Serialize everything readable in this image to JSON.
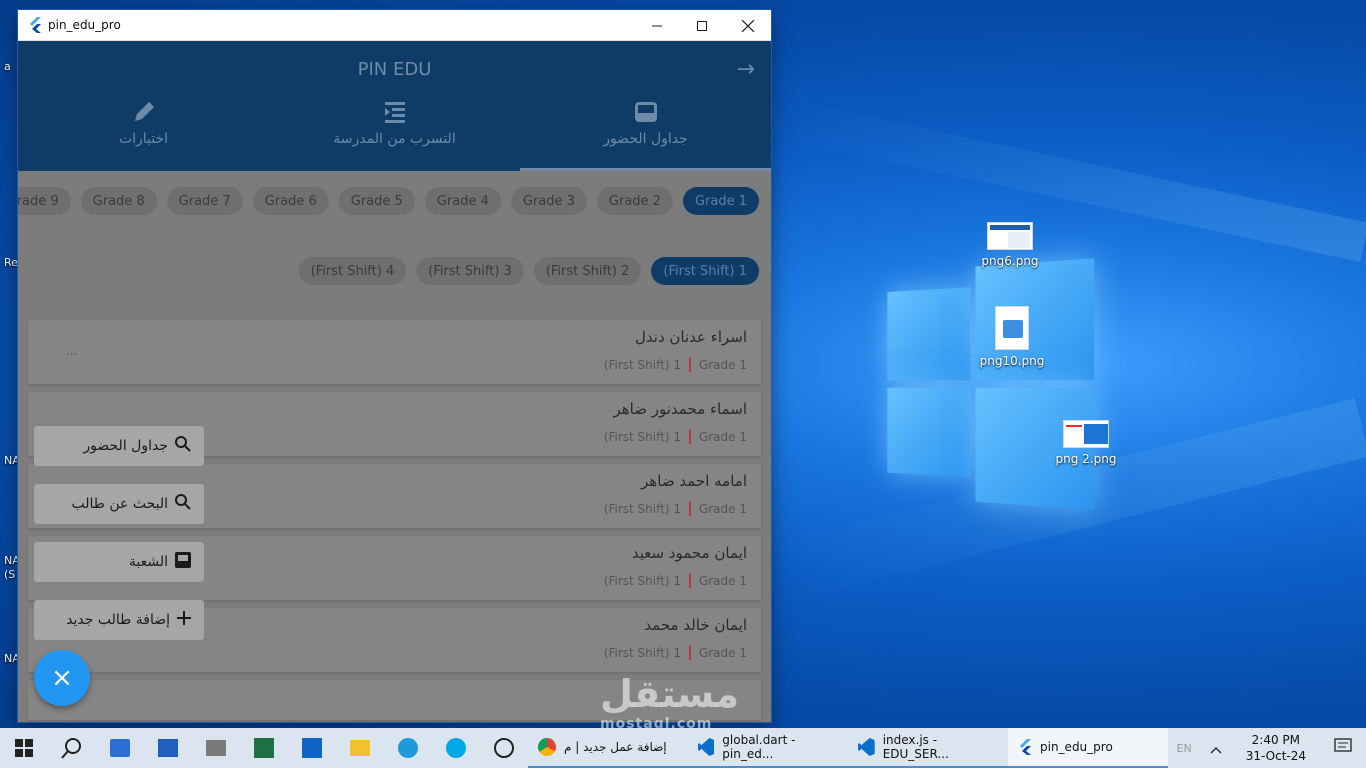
{
  "window": {
    "title": "pin_edu_pro",
    "minimize_icon": "minimize-icon",
    "maximize_icon": "maximize-icon",
    "close_icon": "close-icon"
  },
  "appbar": {
    "title": "PIN EDU",
    "back_symbol": "→",
    "tabs": [
      {
        "label": "جداول الحضور",
        "icon": "inbox-icon",
        "active": true
      },
      {
        "label": "التسرب من المدرسة",
        "icon": "list-indent-icon",
        "active": false
      },
      {
        "label": "اختبارات",
        "icon": "pencil-icon",
        "active": false
      }
    ]
  },
  "grades": [
    "Grade 1",
    "Grade 2",
    "Grade 3",
    "Grade 4",
    "Grade 5",
    "Grade 6",
    "Grade 7",
    "Grade 8",
    "rade 9"
  ],
  "shifts": [
    "(First Shift) 1",
    "(First Shift) 2",
    "(First Shift) 3",
    "(First Shift) 4"
  ],
  "students": [
    {
      "name": "اسراء عدنان دندل",
      "grade": "Grade 1",
      "shift": "(First Shift) 1"
    },
    {
      "name": "اسماء محمدنور ضاهر",
      "grade": "Grade 1",
      "shift": "(First Shift) 1"
    },
    {
      "name": "امامه احمد ضاهر",
      "grade": "Grade 1",
      "shift": "(First Shift) 1"
    },
    {
      "name": "ايمان محمود سعيد",
      "grade": "Grade 1",
      "shift": "(First Shift) 1"
    },
    {
      "name": "ايمان خالد محمد",
      "grade": "Grade 1",
      "shift": "(First Shift) 1"
    }
  ],
  "dots": "...",
  "fab_menu": [
    {
      "label": "جداول الحضور",
      "icon": "search-icon"
    },
    {
      "label": "البحث عن طالب",
      "icon": "search-icon"
    },
    {
      "label": "الشعبة",
      "icon": "inbox-icon"
    },
    {
      "label": "إضافة طالب جديد",
      "icon": "plus-icon"
    }
  ],
  "fab_symbol": "×",
  "watermark": {
    "text": "مستقل",
    "sub": "mostaql.com"
  },
  "desktop_icons": [
    {
      "label": "png6.png"
    },
    {
      "label": "png10.png"
    },
    {
      "label": "png 2.png"
    }
  ],
  "left_edge_labels": [
    "a",
    "Re",
    "NA",
    "NA",
    "(S",
    "NA"
  ],
  "taskbar": {
    "apps": [
      {
        "label": "إضافة عمل جديد | م",
        "icon": "chrome-icon"
      },
      {
        "label": "global.dart - pin_ed...",
        "icon": "vscode-icon"
      },
      {
        "label": "index.js - EDU_SER...",
        "icon": "vscode-icon"
      },
      {
        "label": "pin_edu_pro",
        "icon": "flutter-icon"
      }
    ],
    "time": "2:40 PM",
    "date": "31-Oct-24",
    "tray_text": "EN"
  }
}
